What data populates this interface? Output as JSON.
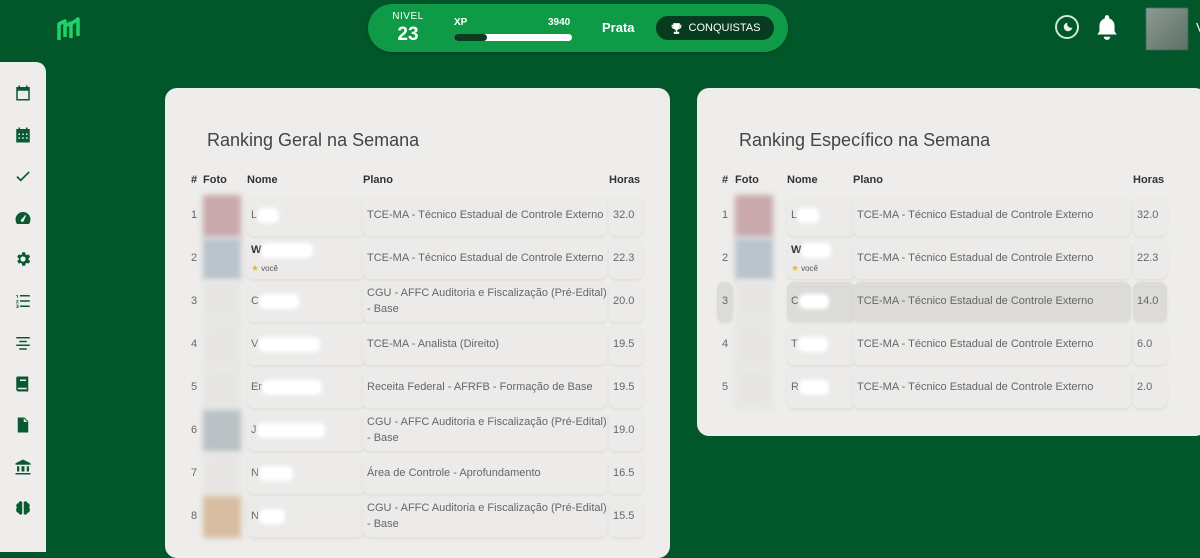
{
  "header": {
    "level_label": "NIVEL",
    "level": "23",
    "xp_label": "XP",
    "xp_value": "3940",
    "xp_progress": 0.28,
    "league": "Prata",
    "achievements_label": "CONQUISTAS",
    "user_initial": "V"
  },
  "sidebar": {
    "items": [
      "calendar-icon",
      "calendar-grid-icon",
      "check-icon",
      "gauge-icon",
      "gear-icon",
      "numbered-list-icon",
      "align-center-icon",
      "book-icon",
      "document-icon",
      "bank-icon",
      "brain-icon"
    ]
  },
  "general": {
    "title": "Ranking Geral na Semana",
    "columns": [
      "#",
      "Foto",
      "Nome",
      "Plano",
      "Horas"
    ],
    "you_label": "você",
    "rows": [
      {
        "rank": "1",
        "name": "L",
        "plan": "TCE-MA - Técnico Estadual de Controle Externo",
        "hours": "32.0"
      },
      {
        "rank": "2",
        "name": "W",
        "plan": "TCE-MA - Técnico Estadual de Controle Externo",
        "hours": "22.3",
        "you": true
      },
      {
        "rank": "3",
        "name": "C",
        "plan": "CGU - AFFC Auditoria e Fiscalização (Pré-Edital) - Base",
        "hours": "20.0"
      },
      {
        "rank": "4",
        "name": "V",
        "plan": "TCE-MA - Analista (Direito)",
        "hours": "19.5"
      },
      {
        "rank": "5",
        "name": "Er",
        "plan": "Receita Federal - AFRFB - Formação de Base",
        "hours": "19.5"
      },
      {
        "rank": "6",
        "name": "J",
        "plan": "CGU - AFFC Auditoria e Fiscalização (Pré-Edital) - Base",
        "hours": "19.0"
      },
      {
        "rank": "7",
        "name": "N",
        "plan": "Área de Controle - Aprofundamento",
        "hours": "16.5"
      },
      {
        "rank": "8",
        "name": "N",
        "plan": "CGU - AFFC Auditoria e Fiscalização (Pré-Edital) - Base",
        "hours": "15.5"
      }
    ]
  },
  "specific": {
    "title": "Ranking Específico na Semana",
    "columns": [
      "#",
      "Foto",
      "Nome",
      "Plano",
      "Horas"
    ],
    "you_label": "você",
    "rows": [
      {
        "rank": "1",
        "name": "L",
        "plan": "TCE-MA - Técnico Estadual de Controle Externo",
        "hours": "32.0"
      },
      {
        "rank": "2",
        "name": "W",
        "plan": "TCE-MA - Técnico Estadual de Controle Externo",
        "hours": "22.3",
        "you": true
      },
      {
        "rank": "3",
        "name": "C",
        "plan": "TCE-MA - Técnico Estadual de Controle Externo",
        "hours": "14.0"
      },
      {
        "rank": "4",
        "name": "T",
        "plan": "TCE-MA - Técnico Estadual de Controle Externo",
        "hours": "6.0"
      },
      {
        "rank": "5",
        "name": "R",
        "plan": "TCE-MA - Técnico Estadual de Controle Externo",
        "hours": "2.0"
      }
    ]
  }
}
